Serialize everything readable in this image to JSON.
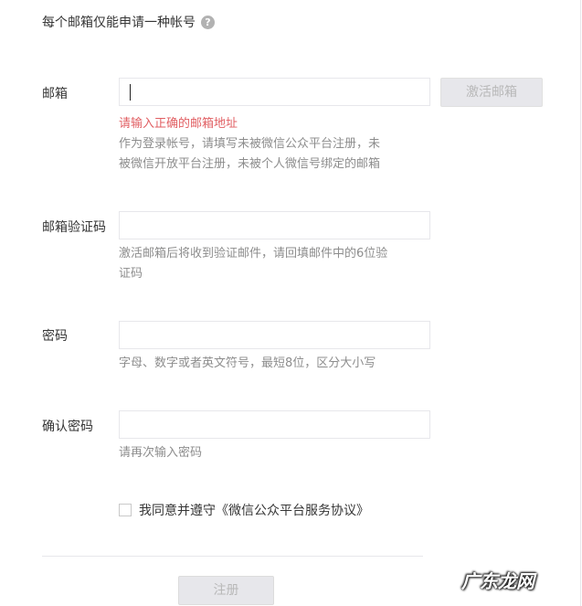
{
  "notice": {
    "text": "每个邮箱仅能申请一种帐号",
    "help_icon": "help-circle-icon"
  },
  "email": {
    "label": "邮箱",
    "value": "",
    "activate_button": "激活邮箱",
    "error": "请输入正确的邮箱地址",
    "tip_line1": "作为登录帐号，请填写未被微信公众平台注册，未",
    "tip_line2": "被微信开放平台注册，未被个人微信号绑定的邮箱"
  },
  "email_code": {
    "label": "邮箱验证码",
    "value": "",
    "tip_line1": "激活邮箱后将收到验证邮件，请回填邮件中的6位验",
    "tip_line2": "证码"
  },
  "password": {
    "label": "密码",
    "value": "",
    "tip": "字母、数字或者英文符号，最短8位，区分大小写"
  },
  "confirm_password": {
    "label": "确认密码",
    "value": "",
    "tip": "请再次输入密码"
  },
  "agreement": {
    "text": "我同意并遵守《微信公众平台服务协议》",
    "checked": false
  },
  "register_button": "注册",
  "watermark": "广东龙网"
}
